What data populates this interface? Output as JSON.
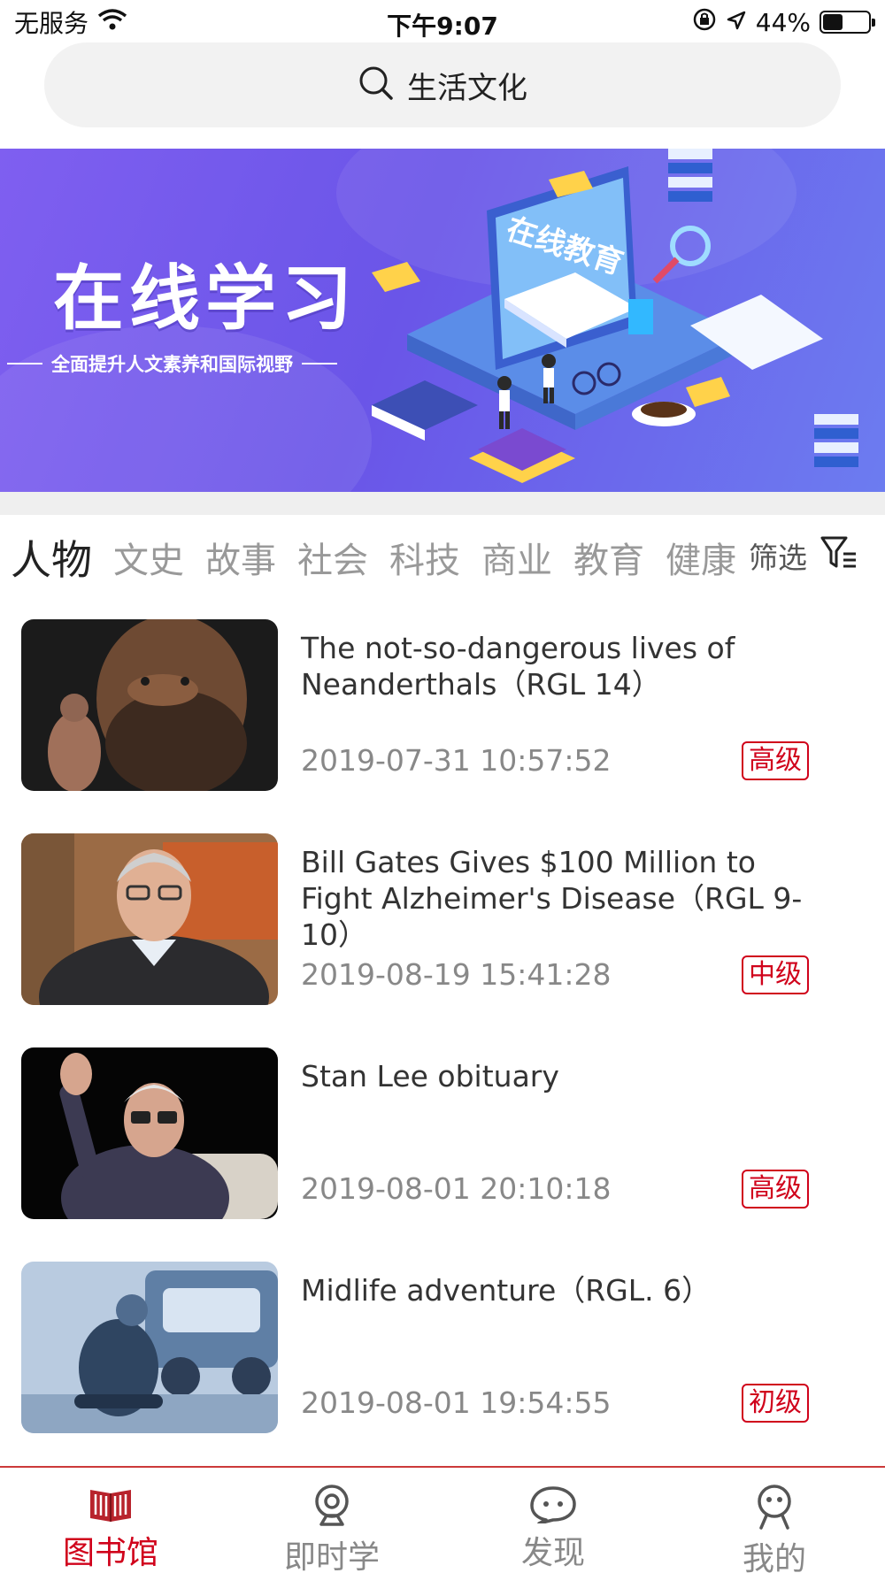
{
  "status_bar": {
    "carrier": "无服务",
    "time": "下午9:07",
    "battery": "44%",
    "battery_level": 0.44
  },
  "search": {
    "placeholder": "生活文化"
  },
  "banner": {
    "title": "在线学习",
    "subtitle": "全面提升人文素养和国际视野",
    "art_label": "在线教育"
  },
  "categories": {
    "items": [
      "人物",
      "文史",
      "故事",
      "社会",
      "科技",
      "商业",
      "教育",
      "健康"
    ],
    "active": "人物",
    "filter_label": "筛选"
  },
  "articles": [
    {
      "title": "The not-so-dangerous lives of Neanderthals（RGL 14）",
      "date": "2019-07-31 10:57:52",
      "level": "高级"
    },
    {
      "title": "Bill Gates Gives $100 Million to Fight Alzheimer's Disease（RGL 9-10）",
      "date": "2019-08-19 15:41:28",
      "level": "中级"
    },
    {
      "title": "Stan Lee obituary",
      "date": "2019-08-01 20:10:18",
      "level": "高级"
    },
    {
      "title": "Midlife adventure（RGL. 6）",
      "date": "2019-08-01 19:54:55",
      "level": "初级"
    }
  ],
  "tabbar": {
    "items": [
      {
        "label": "图书馆",
        "icon": "book-icon",
        "active": true
      },
      {
        "label": "即时学",
        "icon": "webcam-icon",
        "active": false
      },
      {
        "label": "发现",
        "icon": "chat-bubble-icon",
        "active": false
      },
      {
        "label": "我的",
        "icon": "person-icon",
        "active": false
      }
    ]
  },
  "colors": {
    "accent": "#d0021b",
    "banner": "#6a55e8"
  }
}
